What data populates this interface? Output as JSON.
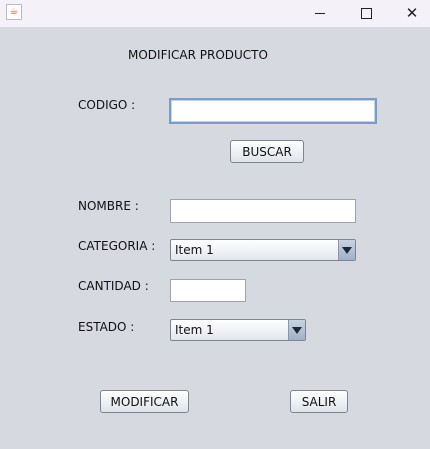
{
  "window": {
    "app_icon": "java-cup-icon",
    "app_icon_glyph": "☕",
    "controls": [
      "minimize",
      "maximize",
      "close"
    ]
  },
  "form": {
    "title": "MODIFICAR PRODUCTO",
    "codigo_label": "CODIGO :",
    "codigo_value": "",
    "buscar_label": "BUSCAR",
    "nombre_label": "NOMBRE :",
    "nombre_value": "",
    "categoria_label": "CATEGORIA :",
    "categoria_value": "Item 1",
    "cantidad_label": "CANTIDAD :",
    "cantidad_value": "",
    "estado_label": "ESTADO  :",
    "estado_value": "Item 1",
    "modificar_label": "MODIFICAR",
    "salir_label": "SALIR"
  }
}
